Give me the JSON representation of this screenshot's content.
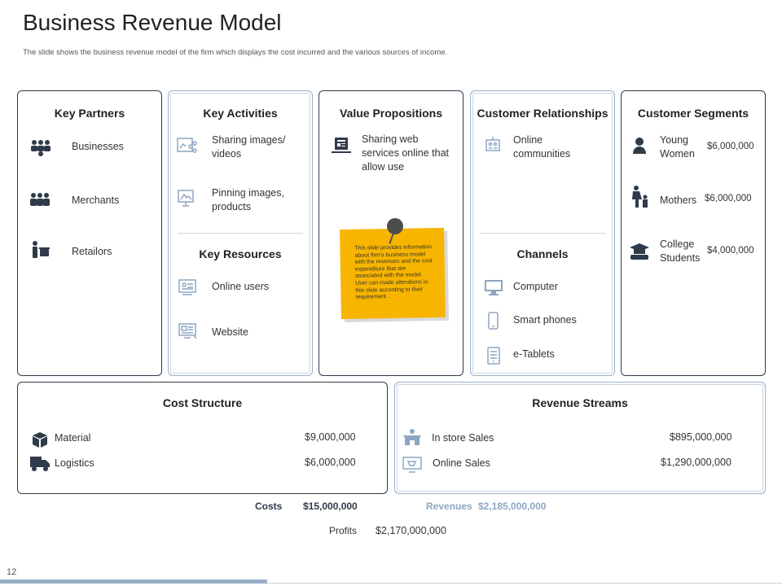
{
  "title": "Business Revenue Model",
  "subtitle": "The slide shows the business revenue model of the firm which displays the cost incurred and the various sources of income.",
  "key_partners": {
    "header": "Key Partners",
    "items": [
      "Businesses",
      "Merchants",
      "Retailors"
    ]
  },
  "key_activities": {
    "header": "Key Activities",
    "items": [
      "Sharing images/ videos",
      "Pinning images, products"
    ]
  },
  "key_resources": {
    "header": "Key Resources",
    "items": [
      "Online users",
      "Website"
    ]
  },
  "value_propositions": {
    "header": "Value Propositions",
    "item": "Sharing web services online that allow use",
    "note": "This slide provides information about firm's business model with the revenues and the cost expenditure that are associated with the model. User can made alterations in this slide according to their requirement."
  },
  "customer_relationships": {
    "header": "Customer Relationships",
    "items": [
      "Online communities"
    ]
  },
  "channels": {
    "header": "Channels",
    "items": [
      "Computer",
      "Smart phones",
      "e-Tablets"
    ]
  },
  "customer_segments": {
    "header": "Customer Segments",
    "items": [
      {
        "label": "Young Women",
        "value": "$6,000,000"
      },
      {
        "label": "Mothers",
        "value": "$6,000,000"
      },
      {
        "label": "College Students",
        "value": "$4,000,000"
      }
    ]
  },
  "cost_structure": {
    "header": "Cost Structure",
    "items": [
      {
        "label": "Material",
        "value": "$9,000,000"
      },
      {
        "label": "Logistics",
        "value": "$6,000,000"
      }
    ]
  },
  "revenue_streams": {
    "header": "Revenue Streams",
    "items": [
      {
        "label": "In store Sales",
        "value": "$895,000,000"
      },
      {
        "label": "Online Sales",
        "value": "$1,290,000,000"
      }
    ]
  },
  "totals": {
    "costs_label": "Costs",
    "costs_value": "$15,000,000",
    "revenues_label": "Revenues",
    "revenues_value": "$2,185,000,000",
    "profits_label": "Profits",
    "profits_value": "$2,170,000,000"
  },
  "page_number": "12",
  "colors": {
    "dark_border": "#2f3a4a",
    "light_border": "#9bb0c8",
    "note": "#f7b500",
    "revenue_text": "#8ea5c2",
    "icon_dark": "#2f3a4a",
    "icon_light": "#8ea5c2"
  }
}
